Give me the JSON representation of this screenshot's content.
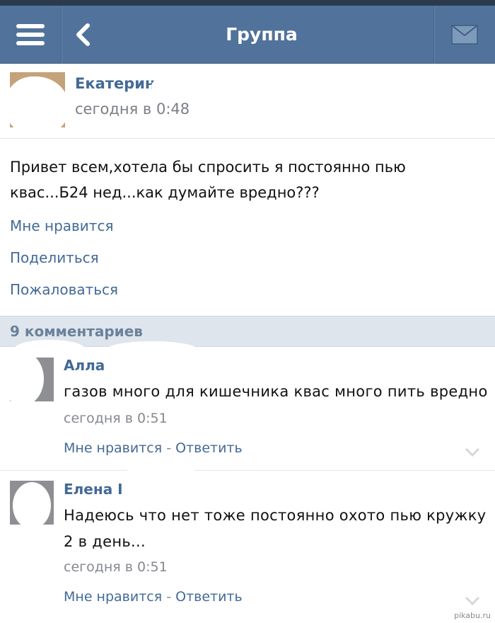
{
  "navbar": {
    "title": "Группа",
    "menu_icon": "hamburger-menu-icon",
    "back_icon": "chevron-left-icon",
    "mail_icon": "envelope-icon"
  },
  "post": {
    "author": "Екатерина",
    "time": "сегодня в 0:48",
    "text": "Привет всем,хотела бы спросить я постоянно пью квас...Б24 нед...как думайте вредно???",
    "actions": {
      "like": "Мне нравится",
      "share": "Поделиться",
      "report": "Пожаловаться"
    }
  },
  "comments_header": "9 комментариев",
  "comments": [
    {
      "author": "Алла",
      "text": "газов много для кишечника квас много пить вредно",
      "time": "сегодня в 0:51",
      "like": "Мне нравится",
      "separator": " - ",
      "reply": "Ответить"
    },
    {
      "author": "Елена I",
      "text": "Надеюсь что нет тоже постоянно охото пью кружку 2 в день...",
      "time": "сегодня в 0:51",
      "like": "Мне нравится",
      "separator": " - ",
      "reply": "Ответить"
    }
  ],
  "watermark": "pikabu.ru",
  "colors": {
    "navbar": "#51739b",
    "link": "#436a96",
    "comments_bar": "#dfe5ec"
  }
}
